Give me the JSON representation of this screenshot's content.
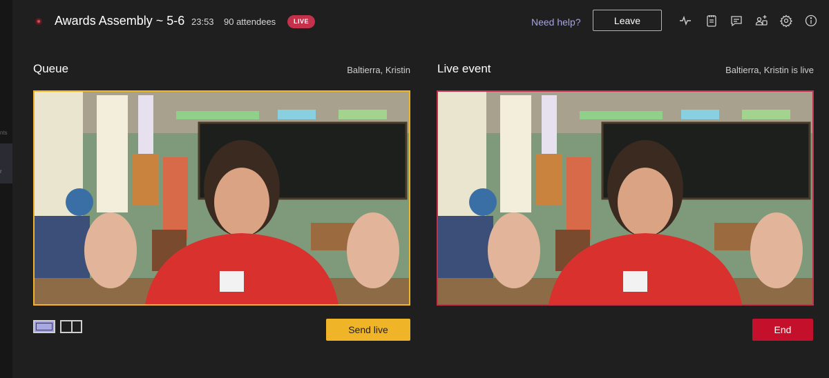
{
  "header": {
    "title": "Awards Assembly ~ 5-6",
    "timer": "23:53",
    "attendees": "90 attendees",
    "live_badge": "LIVE",
    "help_link": "Need help?",
    "leave_label": "Leave",
    "icons": [
      "activity-icon",
      "notes-icon",
      "chat-icon",
      "add-people-icon",
      "settings-icon",
      "info-icon"
    ]
  },
  "queue": {
    "title": "Queue",
    "presenter": "Baltierra, Kristin",
    "send_live_label": "Send live"
  },
  "live_event": {
    "title": "Live event",
    "status": "Baltierra, Kristin is live",
    "end_label": "End"
  },
  "colors": {
    "queue_border": "#f0b429",
    "live_border": "#c4314b",
    "live_badge": "#c4314b",
    "end_button": "#c4102a",
    "help_link": "#a7a4e0",
    "background": "#1f1f1f"
  }
}
